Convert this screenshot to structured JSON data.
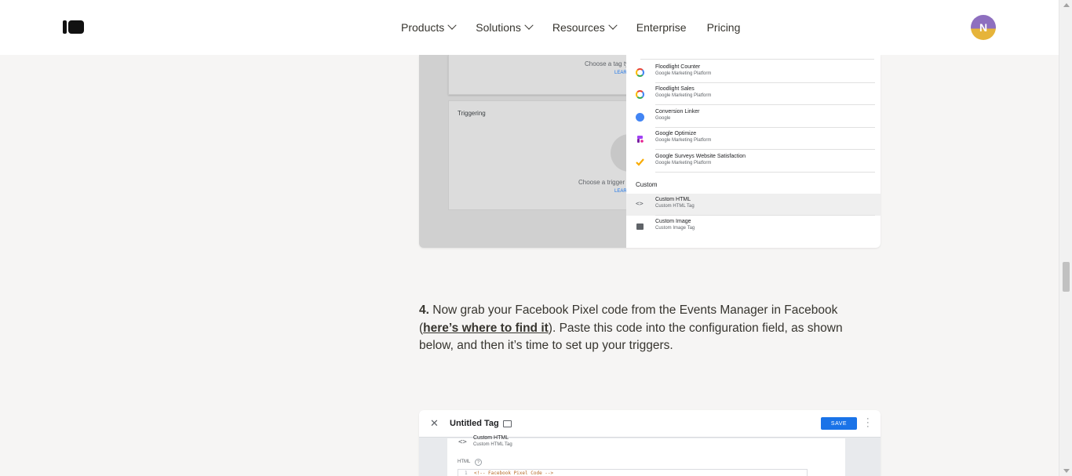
{
  "header": {
    "nav": [
      {
        "label": "Products",
        "dropdown": true
      },
      {
        "label": "Solutions",
        "dropdown": true
      },
      {
        "label": "Resources",
        "dropdown": true
      },
      {
        "label": "Enterprise",
        "dropdown": false
      },
      {
        "label": "Pricing",
        "dropdown": false
      }
    ],
    "avatar_initial": "N"
  },
  "image1": {
    "tag_config_prompt": "Choose a tag ty",
    "tag_config_link": "LEAR",
    "triggering_heading": "Triggering",
    "trigger_prompt": "Choose a trigger t",
    "trigger_link": "LEAR",
    "tags": [
      {
        "name": "Floodlight Counter",
        "sub": "Google Marketing Platform",
        "icon": "google-ring-icon"
      },
      {
        "name": "Floodlight Sales",
        "sub": "Google Marketing Platform",
        "icon": "google-ring-icon"
      },
      {
        "name": "Conversion Linker",
        "sub": "Google",
        "icon": "link-icon"
      },
      {
        "name": "Google Optimize",
        "sub": "Google Marketing Platform",
        "icon": "optimize-icon"
      },
      {
        "name": "Google Surveys Website Satisfaction",
        "sub": "Google Marketing Platform",
        "icon": "check-icon"
      }
    ],
    "custom_heading": "Custom",
    "custom_tags": [
      {
        "name": "Custom HTML",
        "sub": "Custom HTML Tag",
        "icon": "code-icon"
      },
      {
        "name": "Custom Image",
        "sub": "Custom Image Tag",
        "icon": "image-icon"
      }
    ]
  },
  "step": {
    "number": "4.",
    "text_before_link": " Now grab your Facebook Pixel code from the Events Manager in Facebook (",
    "link_text": "here’s where to find it",
    "text_after_link": "). Paste this code into the configuration field, as shown below, and then it’s time to set up your triggers."
  },
  "image2": {
    "close_glyph": "✕",
    "title": "Untitled Tag",
    "save_label": "SAVE",
    "type_name": "Custom HTML",
    "type_sub": "Custom HTML Tag",
    "html_label": "HTML",
    "help_glyph": "?",
    "line_number": "1",
    "code_line": "<!-- Facebook Pixel Code -->"
  },
  "colors": {
    "background": "#f6f5f4",
    "accent_blue": "#1a73e8",
    "avatar_purple": "#8e6fbf",
    "avatar_yellow": "#e6b43a"
  }
}
